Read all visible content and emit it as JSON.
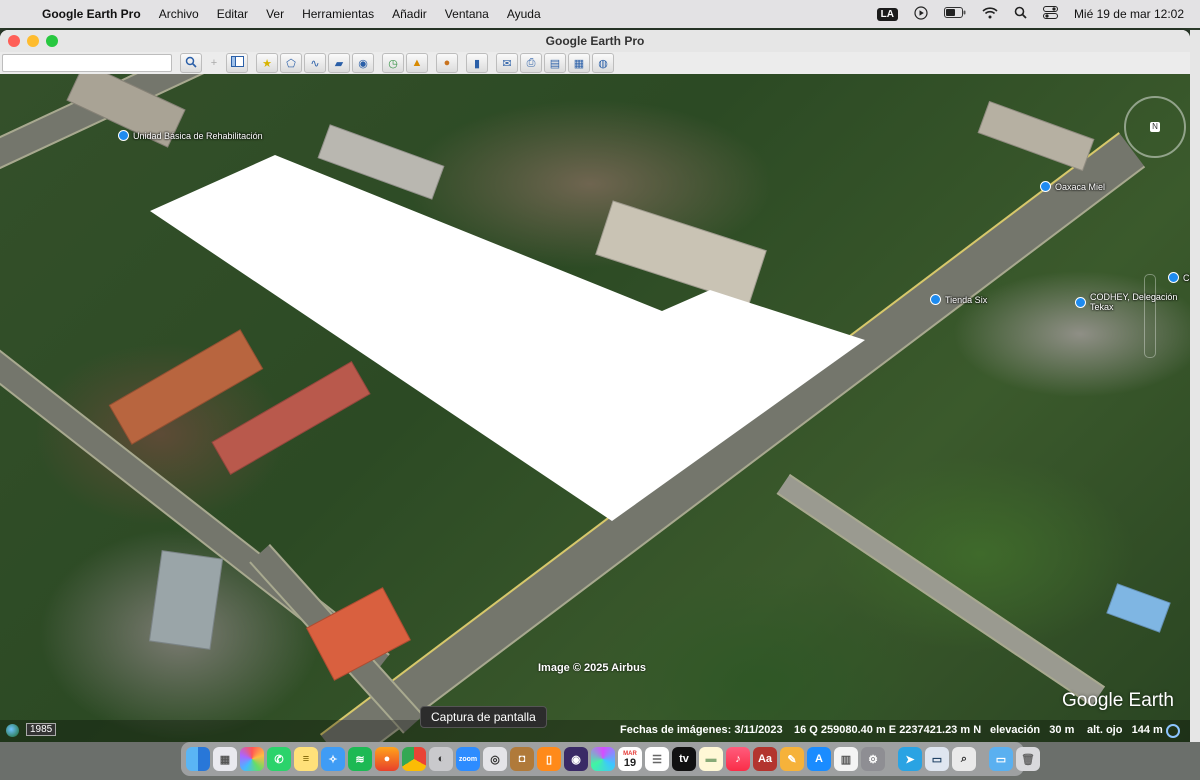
{
  "menubar": {
    "app_name": "Google Earth Pro",
    "menus": [
      "Archivo",
      "Editar",
      "Ver",
      "Herramientas",
      "Añadir",
      "Ventana",
      "Ayuda"
    ],
    "input_source": "LA",
    "datetime": "Mié 19 de mar 12:02"
  },
  "window": {
    "title": "Google Earth Pro"
  },
  "map": {
    "pois": [
      {
        "label": "Unidad Básica de Rehabilitación"
      },
      {
        "label": "Oaxaca Miel"
      },
      {
        "label": "Tienda Six"
      },
      {
        "label": "CODHEY, Delegación Tekax"
      },
      {
        "label": "Ce"
      }
    ],
    "credit": "Image © 2025 Airbus",
    "logo": "Google Earth"
  },
  "statusbar": {
    "historical_year": "1985",
    "imagery_date": "Fechas de imágenes: 3/11/2023",
    "coordinates": "16 Q 259080.40 m E 2237421.23 m N",
    "elevation": "elevación   30 m",
    "eye_altitude": "alt. ojo   144 m"
  },
  "tooltip": "Captura de pantalla",
  "dock": {
    "calendar_day": "19",
    "calendar_month": "MAR",
    "apps": [
      "finder-icon",
      "launchpad-icon",
      "photos-icon",
      "whatsapp-icon",
      "notes-icon",
      "safari-icon",
      "spotify-icon",
      "firefox-icon",
      "chrome-icon",
      "pro-app-icon",
      "zoom-icon",
      "screenshot-icon",
      "brown-app-icon",
      "books-icon",
      "screen-recorder-icon",
      "siri-icon",
      "calendar-icon",
      "reminders-icon",
      "apple-tv-icon",
      "notes-alt-icon",
      "music-icon",
      "dictionary-icon",
      "pencil-app-icon",
      "app-store-icon",
      "preview-icon",
      "settings-icon",
      "telegram-icon",
      "gallery-icon",
      "magnifier-icon",
      "folder-icon",
      "trash-icon"
    ]
  },
  "colors": {
    "parcel_fill": "#ffffff",
    "poi_pin": "#1e8bf0",
    "road_highlight": "#d7c86a"
  }
}
